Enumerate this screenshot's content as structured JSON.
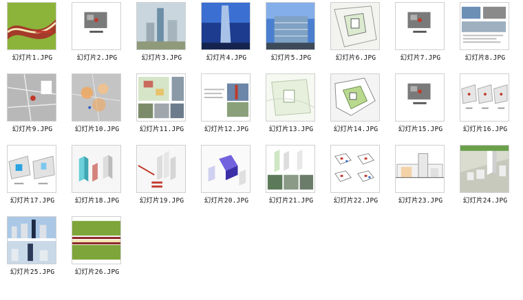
{
  "files": [
    {
      "name": "幻灯片1.JPG",
      "kind": "cover-green"
    },
    {
      "name": "幻灯片2.JPG",
      "kind": "photo-section"
    },
    {
      "name": "幻灯片3.JPG",
      "kind": "city-render"
    },
    {
      "name": "幻灯片4.JPG",
      "kind": "blue-tower"
    },
    {
      "name": "幻灯片5.JPG",
      "kind": "glass-building"
    },
    {
      "name": "幻灯片6.JPG",
      "kind": "site-plan"
    },
    {
      "name": "幻灯片7.JPG",
      "kind": "photo-section"
    },
    {
      "name": "幻灯片8.JPG",
      "kind": "photo-collage"
    },
    {
      "name": "幻灯片9.JPG",
      "kind": "aerial-map"
    },
    {
      "name": "幻灯片10.JPG",
      "kind": "map-circles"
    },
    {
      "name": "幻灯片11.JPG",
      "kind": "plan-photos"
    },
    {
      "name": "幻灯片12.JPG",
      "kind": "text-render"
    },
    {
      "name": "幻灯片13.JPG",
      "kind": "light-plan"
    },
    {
      "name": "幻灯片14.JPG",
      "kind": "green-plan"
    },
    {
      "name": "幻灯片15.JPG",
      "kind": "photo-section"
    },
    {
      "name": "幻灯片16.JPG",
      "kind": "diagram-row"
    },
    {
      "name": "幻灯片17.JPG",
      "kind": "diagram-blue"
    },
    {
      "name": "幻灯片18.JPG",
      "kind": "massing-cyan"
    },
    {
      "name": "幻灯片19.JPG",
      "kind": "massing-red"
    },
    {
      "name": "幻灯片20.JPG",
      "kind": "massing-purple"
    },
    {
      "name": "幻灯片21.JPG",
      "kind": "massing-photos"
    },
    {
      "name": "幻灯片22.JPG",
      "kind": "floor-plans"
    },
    {
      "name": "幻灯片23.JPG",
      "kind": "elevation"
    },
    {
      "name": "幻灯片24.JPG",
      "kind": "model-aerial"
    },
    {
      "name": "幻灯片25.JPG",
      "kind": "skyline"
    },
    {
      "name": "幻灯片26.JPG",
      "kind": "cover-green-bands"
    }
  ]
}
